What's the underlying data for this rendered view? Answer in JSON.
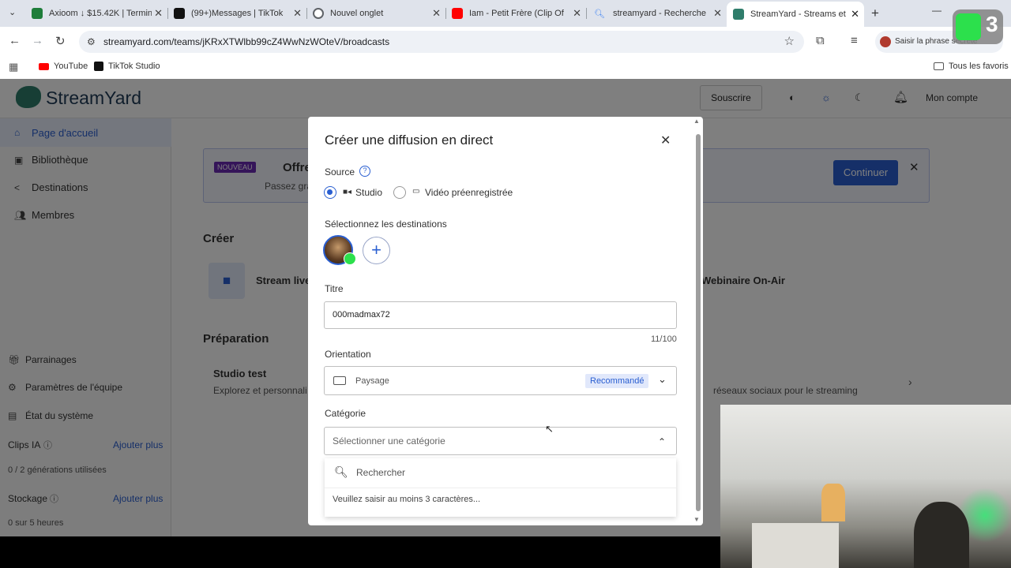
{
  "browser": {
    "tabs": [
      {
        "title": "Axioom ↓ $15.42K | Termin",
        "color": "#1e7d3a"
      },
      {
        "title": "(99+)Messages | TikTok",
        "color": "#111111"
      },
      {
        "title": "Nouvel onglet",
        "color": "#5f6368"
      },
      {
        "title": "Iam - Petit Frère (Clip Offic",
        "color": "#ff0000"
      },
      {
        "title": "streamyard - Recherche",
        "color": "#4285f4"
      },
      {
        "title": "StreamYard - Streams et er",
        "color": "#2f7d6b"
      }
    ],
    "url": "streamyard.com/teams/jKRxXTWlbb99cZ4WwNzWOteV/broadcasts",
    "profile_label": "Saisir la phrase secrète",
    "bookmarks": [
      "YouTube",
      "TikTok Studio"
    ],
    "all_bookmarks": "Tous les favoris",
    "overlay_badge": "3"
  },
  "app": {
    "logo": "StreamYard",
    "header": {
      "subscribe": "Souscrire",
      "account": "Mon compte"
    },
    "sidebar": {
      "items": [
        "Page d'accueil",
        "Bibliothèque",
        "Destinations",
        "Membres"
      ],
      "bottom": [
        "Parrainages",
        "Paramètres de l'équipe",
        "État du système"
      ],
      "clips_label": "Clips IA",
      "clips_add": "Ajouter plus",
      "clips_usage": "0 / 2 générations utilisées",
      "storage_label": "Stockage",
      "storage_add": "Ajouter plus",
      "storage_usage": "0 sur 5 heures"
    },
    "banner": {
      "badge": "NOUVEAU",
      "title": "Offre",
      "sub": "Passez gra",
      "button": "Continuer"
    },
    "create_title": "Créer",
    "create_items": [
      "Stream live",
      "Webinaire On-Air"
    ],
    "prep_title": "Préparation",
    "prep_item_title": "Studio test",
    "prep_item_desc": "Explorez et personnali",
    "prep_item_desc2": "réseaux sociaux pour le streaming"
  },
  "modal": {
    "title": "Créer une diffusion en direct",
    "source_label": "Source",
    "source_options": [
      "Studio",
      "Vidéo préenregistrée"
    ],
    "destinations_label": "Sélectionnez les destinations",
    "title_label": "Titre",
    "title_value": "000madmax72",
    "title_counter": "11/100",
    "orientation_label": "Orientation",
    "orientation_value": "Paysage",
    "orientation_badge": "Recommandé",
    "category_label": "Catégorie",
    "category_placeholder": "Sélectionner une catégorie",
    "search_placeholder": "Rechercher",
    "search_hint": "Veuillez saisir au moins 3 caractères..."
  }
}
